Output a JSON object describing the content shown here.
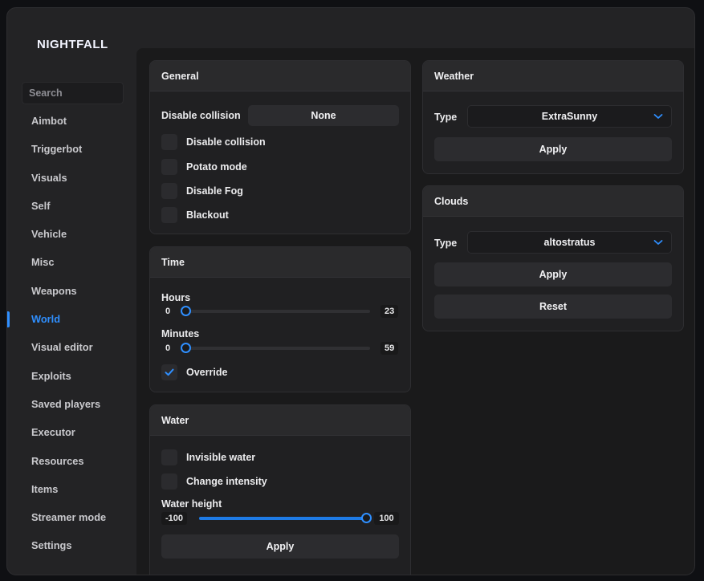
{
  "app": {
    "title": "NIGHTFALL"
  },
  "sidebar": {
    "search_placeholder": "Search",
    "items": [
      {
        "label": "Aimbot"
      },
      {
        "label": "Triggerbot"
      },
      {
        "label": "Visuals"
      },
      {
        "label": "Self"
      },
      {
        "label": "Vehicle"
      },
      {
        "label": "Misc"
      },
      {
        "label": "Weapons"
      },
      {
        "label": "World",
        "active": true
      },
      {
        "label": "Visual editor"
      },
      {
        "label": "Exploits"
      },
      {
        "label": "Saved players"
      },
      {
        "label": "Executor"
      },
      {
        "label": "Resources"
      },
      {
        "label": "Items"
      },
      {
        "label": "Streamer mode"
      },
      {
        "label": "Settings"
      }
    ]
  },
  "general": {
    "title": "General",
    "disable_collision_label": "Disable collision",
    "disable_collision_value": "None",
    "checkboxes": [
      {
        "label": "Disable collision",
        "checked": false
      },
      {
        "label": "Potato mode",
        "checked": false
      },
      {
        "label": "Disable Fog",
        "checked": false
      },
      {
        "label": "Blackout",
        "checked": false
      }
    ]
  },
  "time": {
    "title": "Time",
    "hours": {
      "label": "Hours",
      "min": "0",
      "max": "23",
      "value": 0
    },
    "minutes": {
      "label": "Minutes",
      "min": "0",
      "max": "59",
      "value": 0
    },
    "override": {
      "label": "Override",
      "checked": true
    }
  },
  "water": {
    "title": "Water",
    "checkboxes": [
      {
        "label": "Invisible water",
        "checked": false
      },
      {
        "label": "Change intensity",
        "checked": false
      }
    ],
    "height": {
      "label": "Water height",
      "min": "-100",
      "max": "100",
      "value": 100
    },
    "apply_label": "Apply"
  },
  "weather": {
    "title": "Weather",
    "type_label": "Type",
    "type_value": "ExtraSunny",
    "apply_label": "Apply"
  },
  "clouds": {
    "title": "Clouds",
    "type_label": "Type",
    "type_value": "altostratus",
    "apply_label": "Apply",
    "reset_label": "Reset"
  },
  "colors": {
    "accent": "#2f8fff",
    "panel": "#202022",
    "background": "#1a1a1b"
  }
}
